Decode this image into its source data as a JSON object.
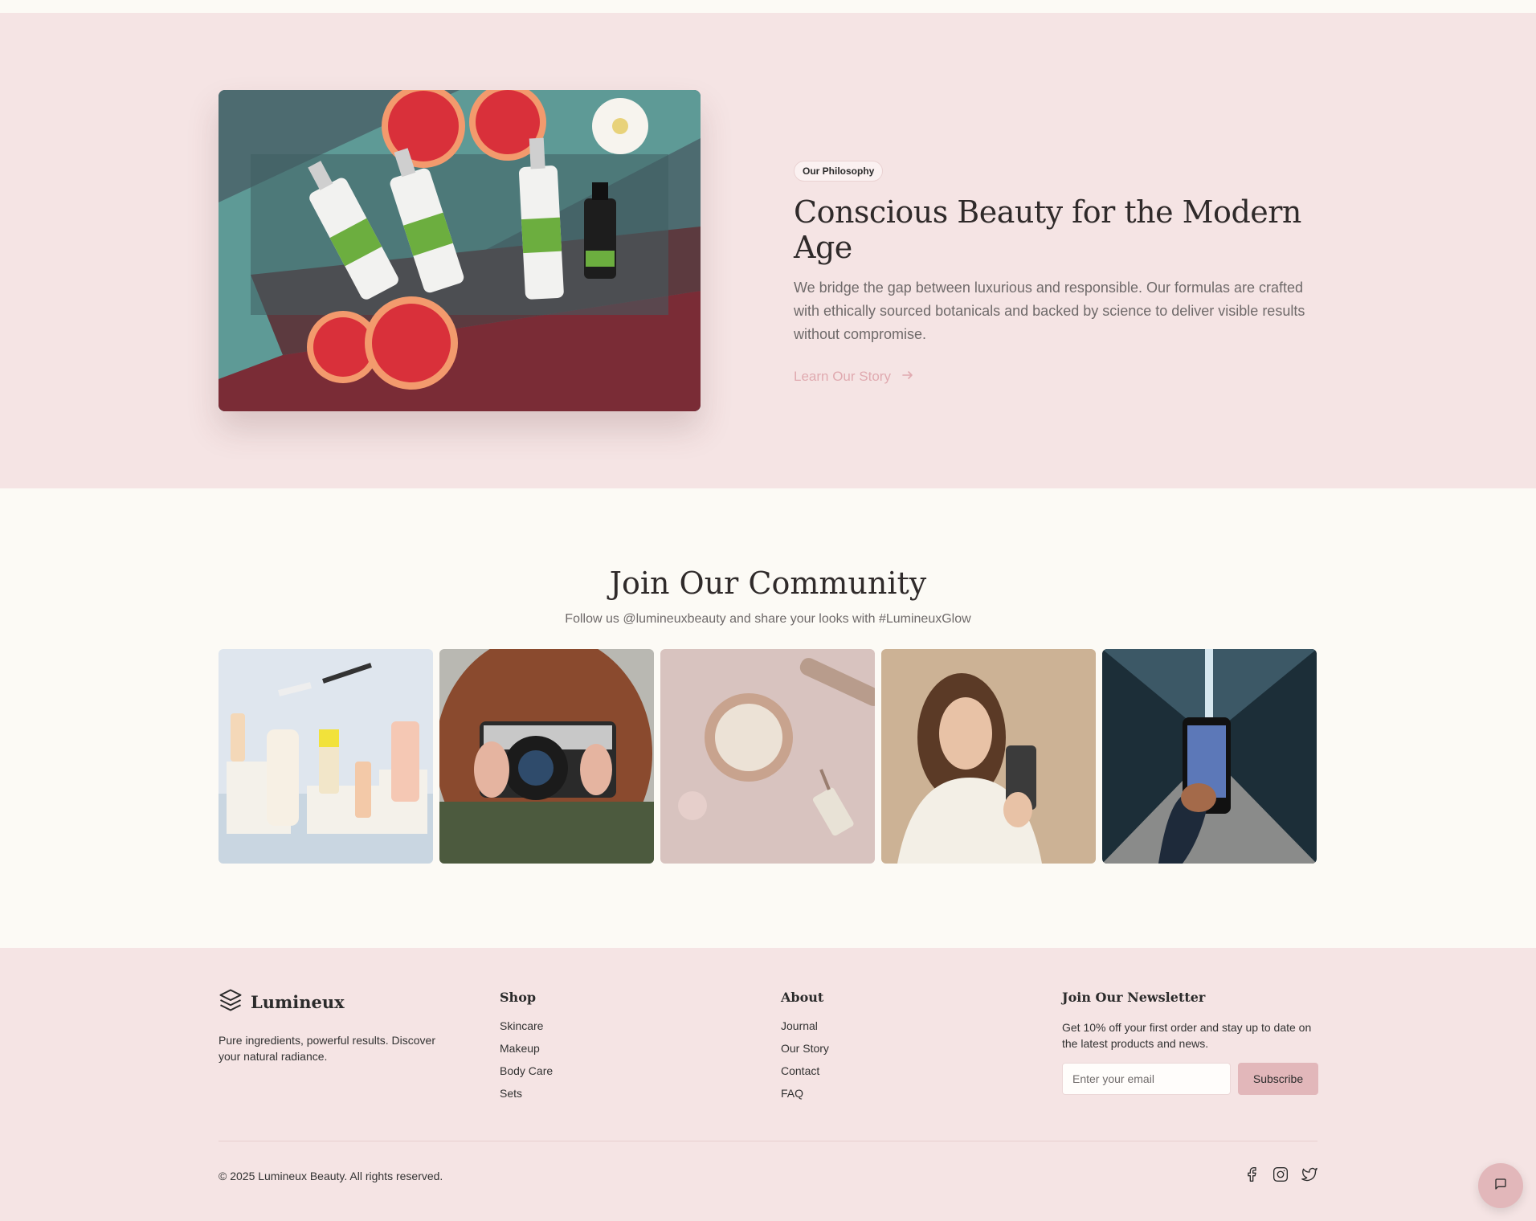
{
  "philosophy": {
    "badge": "Our Philosophy",
    "title": "Conscious Beauty for the Modern Age",
    "body": "We bridge the gap between luxurious and responsible. Our formulas are crafted with ethically sourced botanicals and backed by science to deliver visible results without compromise.",
    "link_label": "Learn Our Story",
    "link_icon": "arrow-right-icon"
  },
  "community": {
    "title": "Join Our Community",
    "subtitle": "Follow us @lumineuxbeauty and share your looks with #LumineuxGlow",
    "gallery_count_shown": 5
  },
  "footer": {
    "brand": {
      "name": "Lumineux",
      "logo_icon": "layers-icon",
      "description": "Pure ingredients, powerful results. Discover your natural radiance."
    },
    "shop": {
      "heading": "Shop",
      "links": [
        "Skincare",
        "Makeup",
        "Body Care",
        "Sets"
      ]
    },
    "about": {
      "heading": "About",
      "links": [
        "Journal",
        "Our Story",
        "Contact",
        "FAQ"
      ]
    },
    "newsletter": {
      "heading": "Join Our Newsletter",
      "description": "Get 10% off your first order and stay up to date on the latest products and news.",
      "email_placeholder": "Enter your email",
      "email_value": "",
      "button_label": "Subscribe"
    },
    "copyright": "© 2025 Lumineux Beauty. All rights reserved.",
    "social_icons": [
      "facebook-icon",
      "instagram-icon",
      "twitter-icon"
    ]
  },
  "chat": {
    "icon": "chat-bubble-icon"
  },
  "colors": {
    "background": "#fcfaf5",
    "section_pink": "#f5e4e4",
    "accent": "#e2b7ba",
    "link_pink": "#e0aab0",
    "heading": "#2f2a2a",
    "muted_text": "#6f6a6a"
  }
}
